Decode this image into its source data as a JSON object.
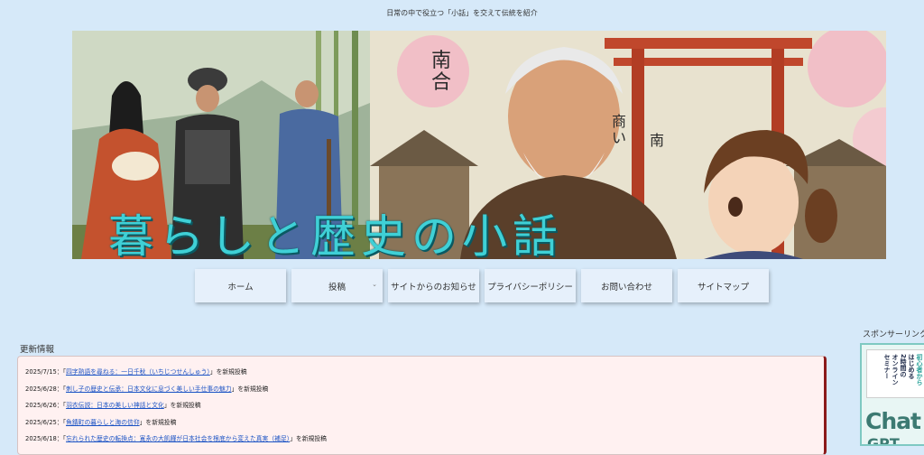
{
  "site": {
    "tagline": "日常の中で役立つ「小話」を交えて伝統を紹介",
    "banner_title": "暮らしと歴史の小話",
    "banner_signs": [
      "南合",
      "商い",
      "南"
    ]
  },
  "nav": {
    "items": [
      {
        "label": "ホーム"
      },
      {
        "label": "投稿",
        "has_dropdown": true
      },
      {
        "label": "サイトからのお知らせ"
      },
      {
        "label": "プライバシーポリシー"
      },
      {
        "label": "お問い合わせ"
      },
      {
        "label": "サイトマップ"
      }
    ],
    "chevron": "⌄"
  },
  "updates": {
    "heading": "更新情報",
    "items": [
      {
        "date": "2025/7/15：",
        "pre": "「",
        "link": "四字熟語を尋ねる：一日千秋（いちじつせんしゅう）",
        "post": "」を新規投稿"
      },
      {
        "date": "2025/6/28：",
        "pre": "「",
        "link": "刺し子の歴史と伝承：日本文化に息づく美しい手仕事の魅力",
        "post": "」を新規投稿"
      },
      {
        "date": "2025/6/26：",
        "pre": "「",
        "link": "羽衣伝説：日本の美しい神話と文化",
        "post": "」を新規投稿"
      },
      {
        "date": "2025/6/25：",
        "pre": "「",
        "link": "魚錆町の暮らしと海の信仰",
        "post": "」を新規投稿"
      },
      {
        "date": "2025/6/18：",
        "pre": "「",
        "link": "忘れられた歴史の転換点：寛永の大飢饉が日本社会を根底から変えた真実（補足）",
        "post": "」を新規投稿"
      }
    ]
  },
  "sponsor": {
    "label": "スポンサーリンク",
    "ad_lines": [
      "初心者から",
      "はじめる",
      "2時間の",
      "オンライン",
      "セミナー"
    ],
    "ad_big": "Chat",
    "ad_big2": "GPT"
  },
  "colors": {
    "page_bg": "#d6e9f9",
    "title_cyan": "#3fd0d6",
    "link_blue": "#1a52c4",
    "news_bg": "#fff1f1",
    "news_border_accent": "#8b1a1a"
  }
}
